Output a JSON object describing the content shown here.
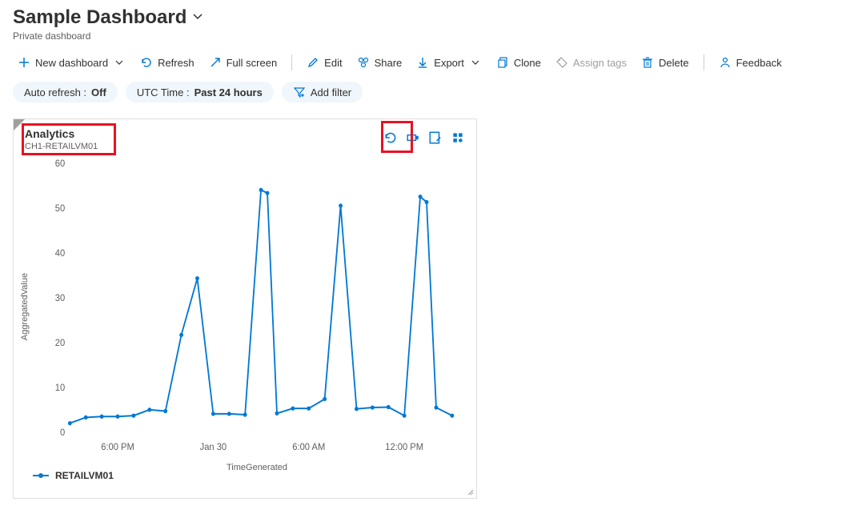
{
  "header": {
    "title": "Sample Dashboard",
    "subtitle": "Private dashboard"
  },
  "toolbar": {
    "new_dashboard": "New dashboard",
    "refresh": "Refresh",
    "full_screen": "Full screen",
    "edit": "Edit",
    "share": "Share",
    "export": "Export",
    "clone": "Clone",
    "assign_tags": "Assign tags",
    "delete": "Delete",
    "feedback": "Feedback"
  },
  "pills": {
    "auto_refresh_label": "Auto refresh :",
    "auto_refresh_value": "Off",
    "time_label": "UTC Time :",
    "time_value": "Past 24 hours",
    "add_filter": "Add filter"
  },
  "tile": {
    "title": "Analytics",
    "subtitle": "CH1-RETAILVM01",
    "legend_series": "RETAILVM01"
  },
  "chart_data": {
    "type": "line",
    "title": "Analytics",
    "xlabel": "TimeGenerated",
    "ylabel": "AggregatedValue",
    "ylim": [
      0,
      60
    ],
    "y_ticks": [
      0,
      10,
      20,
      30,
      40,
      50,
      60
    ],
    "x_tick_labels": [
      "6:00 PM",
      "Jan 30",
      "6:00 AM",
      "12:00 PM"
    ],
    "x_tick_positions": [
      3,
      9,
      15,
      21
    ],
    "series": [
      {
        "name": "RETAILVM01",
        "color": "#0078d4",
        "points": [
          {
            "i": 0,
            "v": 2.0
          },
          {
            "i": 1,
            "v": 3.3
          },
          {
            "i": 2,
            "v": 3.5
          },
          {
            "i": 3,
            "v": 3.5
          },
          {
            "i": 4,
            "v": 3.7
          },
          {
            "i": 5,
            "v": 5.0
          },
          {
            "i": 6,
            "v": 4.7
          },
          {
            "i": 7,
            "v": 21.7
          },
          {
            "i": 8,
            "v": 34.3
          },
          {
            "i": 9,
            "v": 4.1
          },
          {
            "i": 10,
            "v": 4.1
          },
          {
            "i": 11,
            "v": 3.9
          },
          {
            "i": 12,
            "v": 54.0
          },
          {
            "i": 12.4,
            "v": 53.3
          },
          {
            "i": 13,
            "v": 4.2
          },
          {
            "i": 14,
            "v": 5.3
          },
          {
            "i": 15,
            "v": 5.3
          },
          {
            "i": 16,
            "v": 7.4
          },
          {
            "i": 17,
            "v": 50.5
          },
          {
            "i": 18,
            "v": 5.2
          },
          {
            "i": 19,
            "v": 5.5
          },
          {
            "i": 20,
            "v": 5.6
          },
          {
            "i": 21,
            "v": 3.7
          },
          {
            "i": 22,
            "v": 52.5
          },
          {
            "i": 22.4,
            "v": 51.3
          },
          {
            "i": 23,
            "v": 5.5
          },
          {
            "i": 24,
            "v": 3.7
          }
        ]
      }
    ]
  }
}
